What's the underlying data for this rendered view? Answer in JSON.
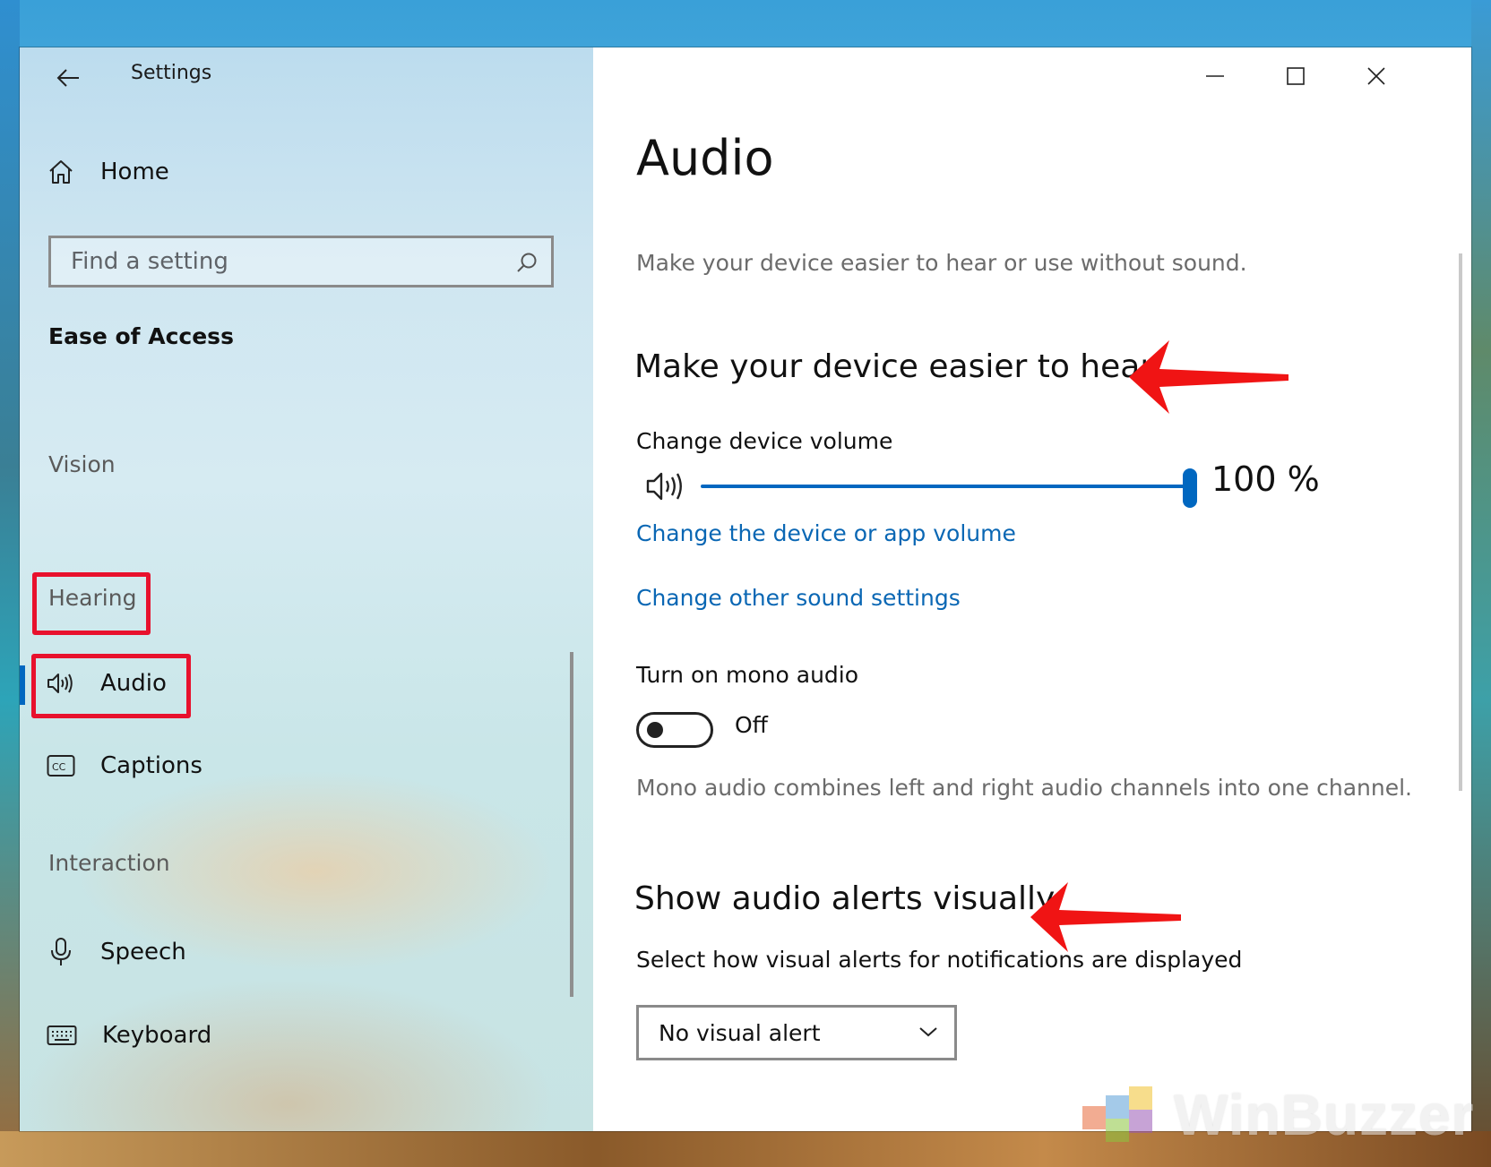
{
  "window": {
    "app_title": "Settings",
    "controls": {
      "minimize": "minimize",
      "maximize": "maximize",
      "close": "close"
    }
  },
  "sidebar": {
    "home_label": "Home",
    "search": {
      "placeholder": "Find a setting"
    },
    "section_title": "Ease of Access",
    "categories": {
      "vision": "Vision",
      "hearing": "Hearing",
      "interaction": "Interaction"
    },
    "items": [
      {
        "id": "audio",
        "label": "Audio",
        "icon": "speaker-icon",
        "selected": true
      },
      {
        "id": "captions",
        "label": "Captions",
        "icon": "captions-icon"
      },
      {
        "id": "speech",
        "label": "Speech",
        "icon": "microphone-icon"
      },
      {
        "id": "keyboard",
        "label": "Keyboard",
        "icon": "keyboard-icon"
      }
    ]
  },
  "main": {
    "title": "Audio",
    "description": "Make your device easier to hear or use without sound.",
    "hear_section": {
      "heading": "Make your device easier to hear",
      "volume_label": "Change device volume",
      "volume_value": 100,
      "volume_text": "100 %",
      "link_app_volume": "Change the device or app volume",
      "link_sound_settings": "Change other sound settings"
    },
    "mono": {
      "label": "Turn on mono audio",
      "state": "Off",
      "enabled": false,
      "description": "Mono audio combines left and right audio channels into one channel."
    },
    "alerts_section": {
      "heading": "Show audio alerts visually",
      "select_label": "Select how visual alerts for notifications are displayed",
      "selected_option": "No visual alert"
    }
  },
  "annotations": {
    "highlight_color": "#e8112d",
    "arrow_color": "#f01414"
  },
  "accent_color": "#0067c0",
  "link_color": "#0a67b4",
  "watermark": {
    "text": "WinBuzzer"
  }
}
